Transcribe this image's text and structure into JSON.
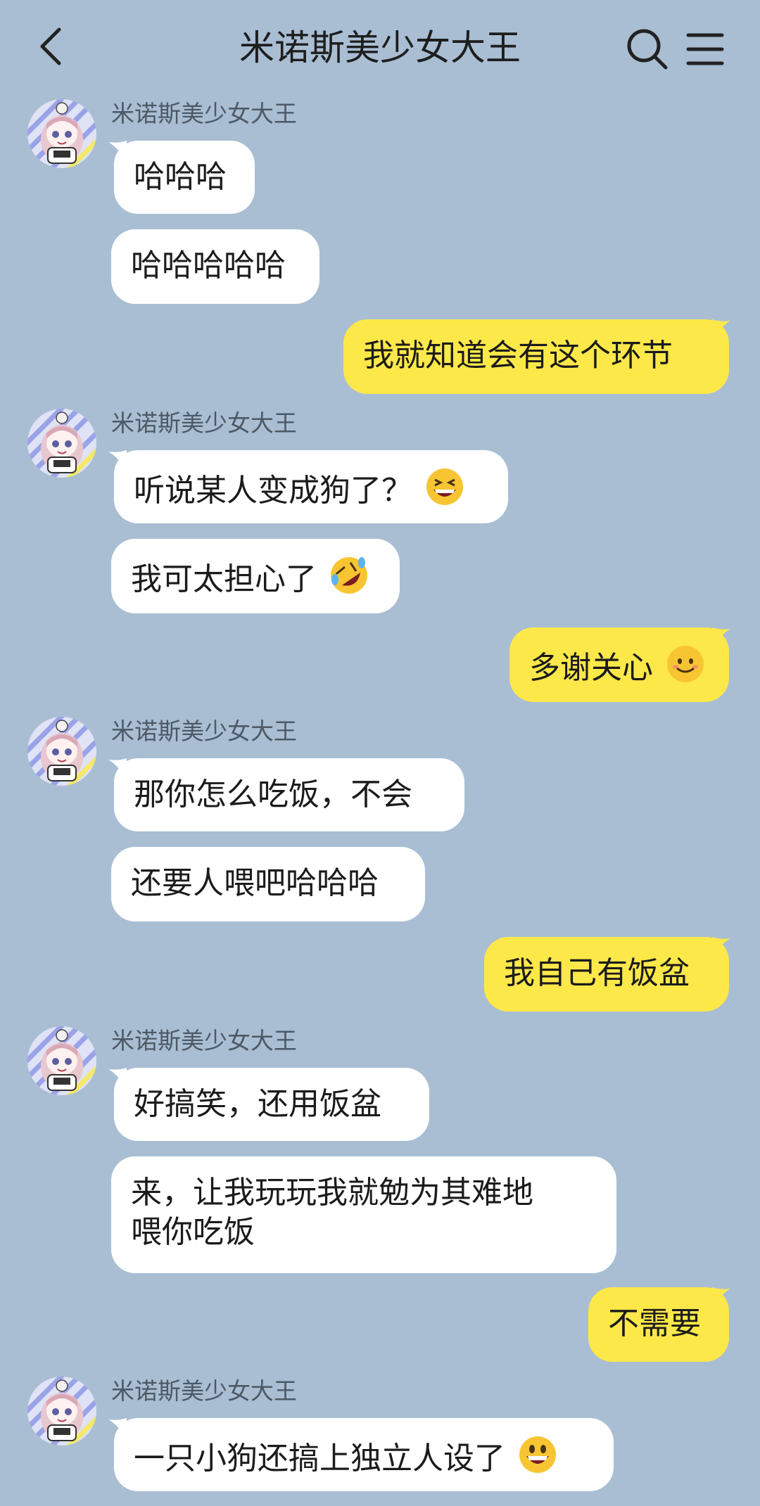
{
  "header": {
    "title": "米诺斯美少女大王",
    "back_icon": "chevron-left-icon",
    "search_icon": "search-icon",
    "menu_icon": "menu-icon"
  },
  "colors": {
    "background": "#a9bed3",
    "incoming_bubble": "#ffffff",
    "outgoing_bubble": "#fde84a"
  },
  "messages": [
    {
      "sender": "米诺斯美少女大王",
      "text": "哈哈哈"
    },
    {
      "text": "哈哈哈哈哈"
    },
    {
      "text": "我就知道会有这个环节"
    },
    {
      "sender": "米诺斯美少女大王",
      "text": "听说某人变成狗了？",
      "emoji": "grinning-squinting-face"
    },
    {
      "text": "我可太担心了",
      "emoji": "rolling-on-floor-laughing"
    },
    {
      "text": "多谢关心",
      "emoji": "smiling-face"
    },
    {
      "sender": "米诺斯美少女大王",
      "text": "那你怎么吃饭，不会"
    },
    {
      "text": "还要人喂吧哈哈哈"
    },
    {
      "text": "我自己有饭盆"
    },
    {
      "sender": "米诺斯美少女大王",
      "text": "好搞笑，还用饭盆"
    },
    {
      "text_line1": "来，让我玩玩我就勉为其难地",
      "text_line2": "喂你吃饭"
    },
    {
      "text": "不需要"
    },
    {
      "sender": "米诺斯美少女大王",
      "text": "一只小狗还搞上独立人设了",
      "emoji": "grinning-face"
    }
  ]
}
